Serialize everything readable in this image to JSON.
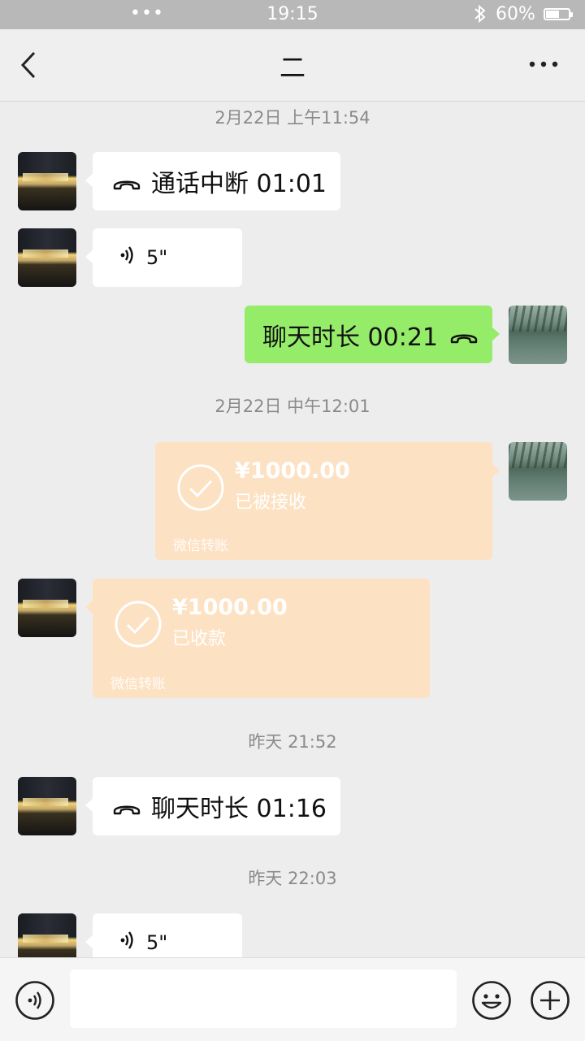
{
  "status_bar": {
    "dots": "•••",
    "time": "19:15",
    "bluetooth_icon": "bluetooth-icon",
    "battery_text": "60%",
    "battery_level": 0.6
  },
  "nav": {
    "title": "二",
    "back_icon": "chevron-left-icon",
    "more_icon": "more-dots-icon"
  },
  "messages": {
    "ts1": "2月22日 上午11:54",
    "call1_text": "通话中断 01:01",
    "voice1_text": "5\"",
    "call2_text": "聊天时长 00:21",
    "ts2": "2月22日 中午12:01",
    "transfer1": {
      "amount": "¥1000.00",
      "status": "已被接收",
      "brand": "微信转账"
    },
    "transfer2": {
      "amount": "¥1000.00",
      "status": "已收款",
      "brand": "微信转账"
    },
    "ts3": "昨天 21:52",
    "call3_text": "聊天时长 01:16",
    "ts4": "昨天 22:03",
    "voice2_text": "5\""
  },
  "input_bar": {
    "voice_icon": "voice-toggle-icon",
    "emoji_icon": "emoji-icon",
    "plus_icon": "plus-icon",
    "input_value": ""
  },
  "colors": {
    "sent_bubble": "#95ec69",
    "received_bubble": "#ffffff",
    "transfer_card": "#fde1c3",
    "background": "#ededed"
  }
}
